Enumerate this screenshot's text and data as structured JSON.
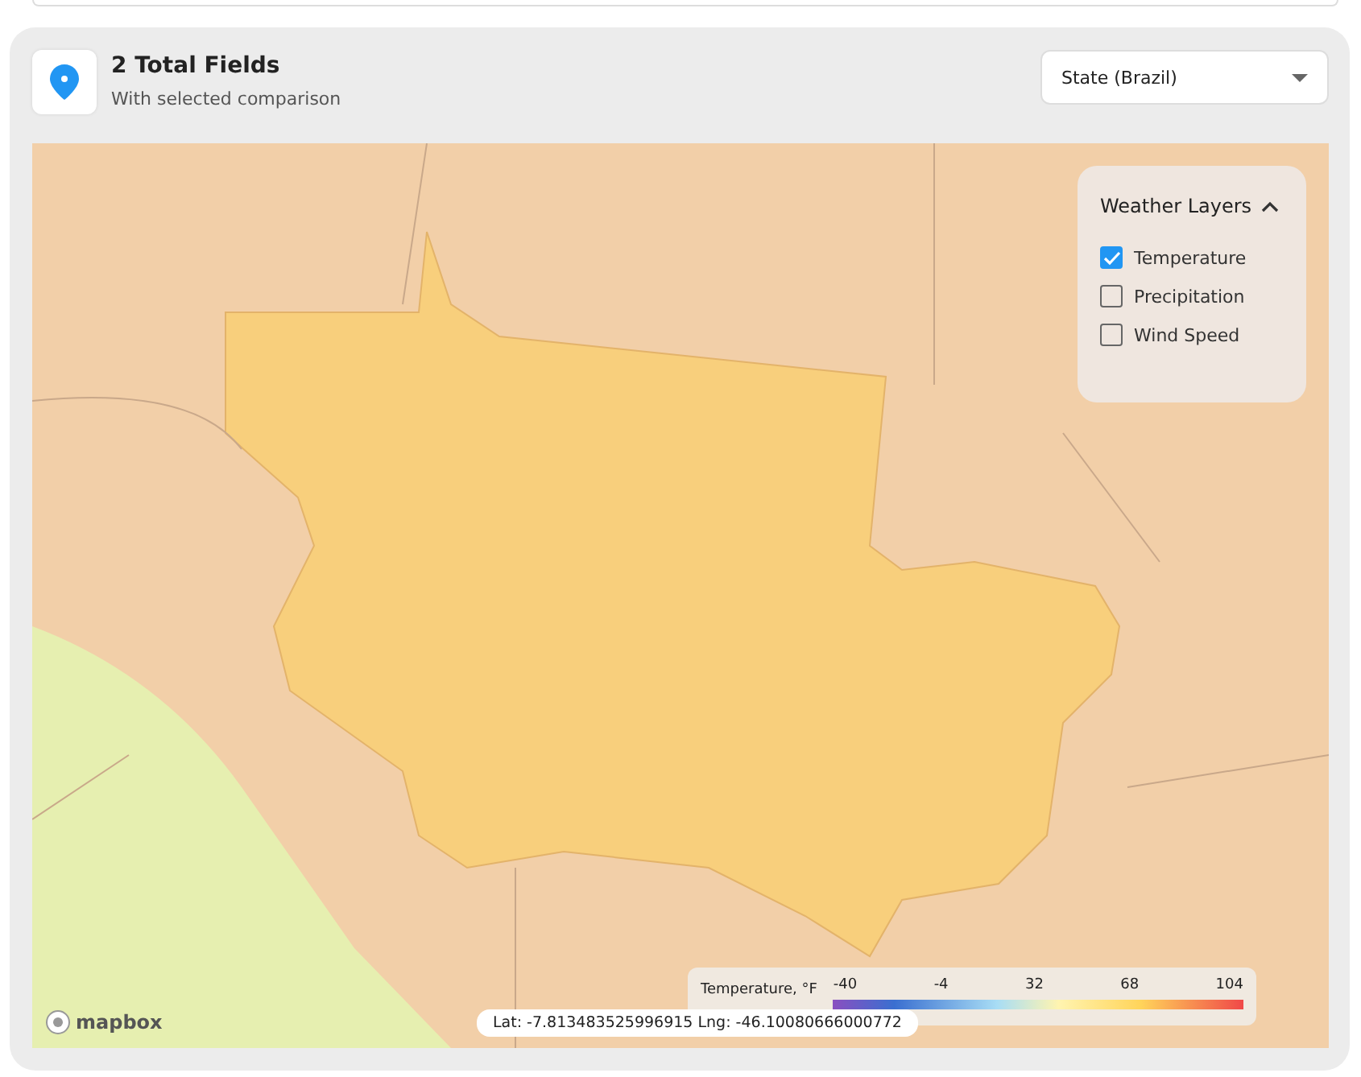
{
  "header": {
    "title": "2 Total Fields",
    "subtitle": "With selected comparison"
  },
  "dropdown": {
    "value": "State (Brazil)"
  },
  "weather_layers": {
    "title": "Weather Layers",
    "expanded": true,
    "items": [
      {
        "label": "Temperature",
        "checked": true
      },
      {
        "label": "Precipitation",
        "checked": false
      },
      {
        "label": "Wind Speed",
        "checked": false
      }
    ]
  },
  "legend": {
    "title": "Temperature, °F",
    "ticks": [
      "-40",
      "-4",
      "32",
      "68",
      "104"
    ]
  },
  "coordinates": "Lat: -7.813483525996915 Lng: -46.10080666000772",
  "attribution": "mapbox"
}
